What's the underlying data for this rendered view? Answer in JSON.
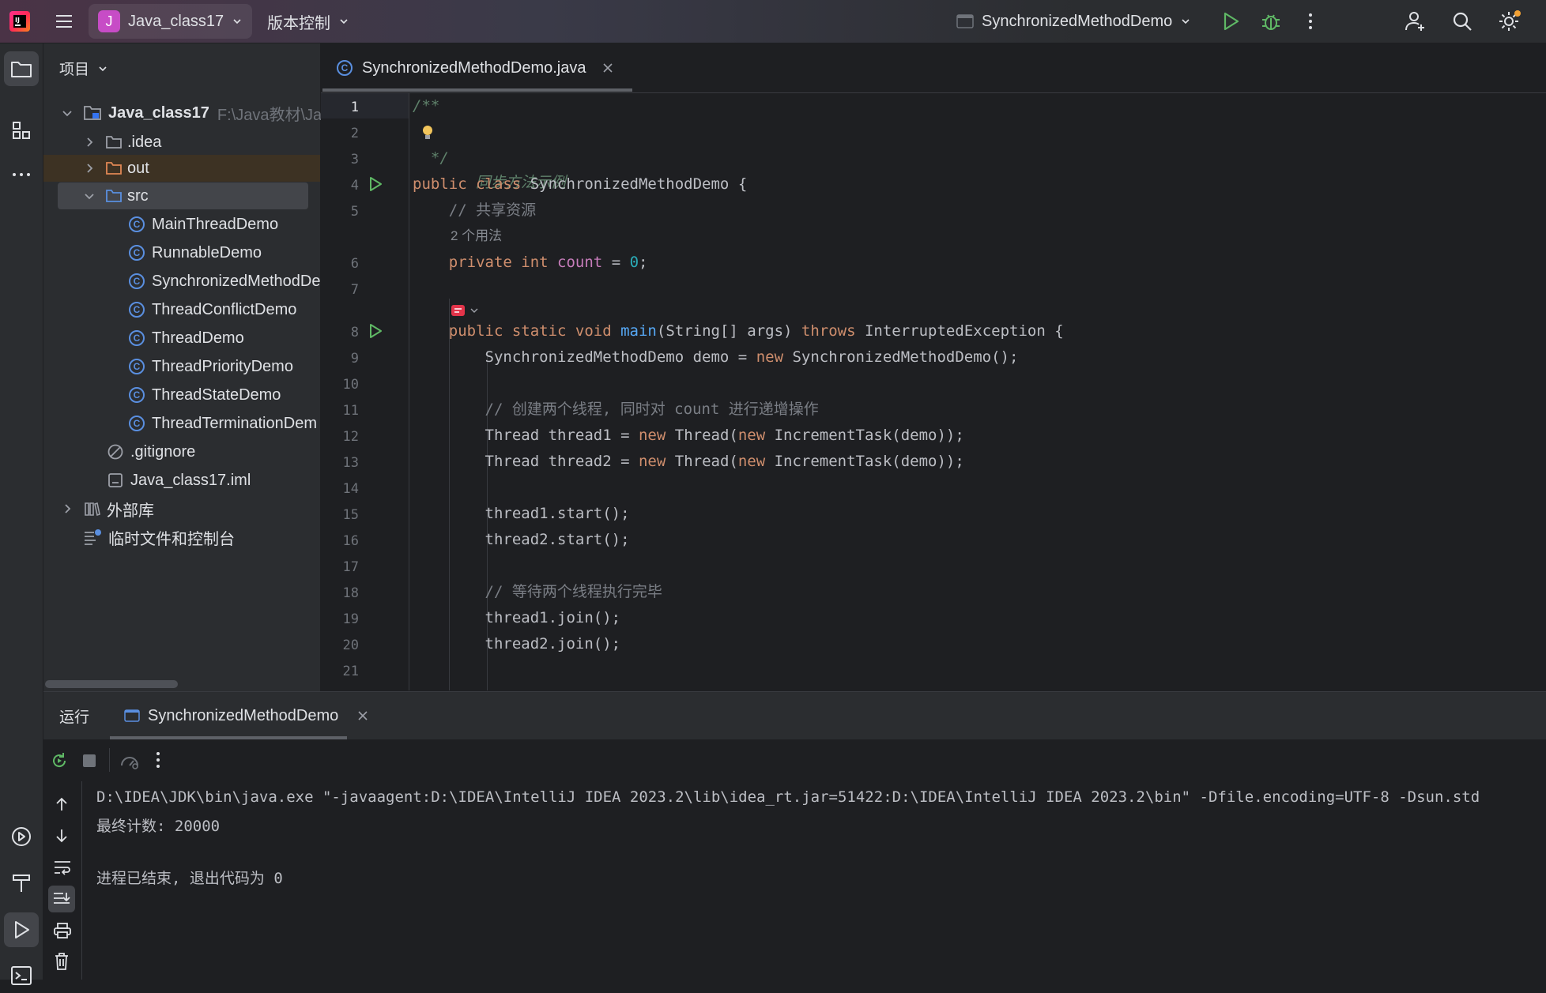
{
  "titlebar": {
    "project_badge": "J",
    "project_name": "Java_class17",
    "vcs_label": "版本控制",
    "run_config": "SynchronizedMethodDemo",
    "icons": [
      "ide-logo-icon",
      "hamburger-menu-icon",
      "run-icon",
      "debug-icon",
      "more-vertical-icon",
      "add-user-icon",
      "search-icon",
      "settings-icon"
    ]
  },
  "project_panel": {
    "header": "项目",
    "root": {
      "name": "Java_class17",
      "path": "F:\\Java教材\\Ja"
    },
    "items": [
      {
        "label": ".idea"
      },
      {
        "label": "out"
      },
      {
        "label": "src"
      },
      {
        "label": "MainThreadDemo"
      },
      {
        "label": "RunnableDemo"
      },
      {
        "label": "SynchronizedMethodDe"
      },
      {
        "label": "ThreadConflictDemo"
      },
      {
        "label": "ThreadDemo"
      },
      {
        "label": "ThreadPriorityDemo"
      },
      {
        "label": "ThreadStateDemo"
      },
      {
        "label": "ThreadTerminationDem"
      },
      {
        "label": ".gitignore"
      },
      {
        "label": "Java_class17.iml"
      },
      {
        "label": "外部库"
      },
      {
        "label": "临时文件和控制台"
      }
    ]
  },
  "editor": {
    "tab_label": "SynchronizedMethodDemo.java",
    "class_icon_letter": "C",
    "line_numbers": [
      "1",
      "2",
      "3",
      "4",
      "5",
      "6",
      "7",
      "8",
      "9",
      "10",
      "11",
      "12",
      "13",
      "14",
      "15",
      "16",
      "17",
      "18",
      "19",
      "20",
      "21"
    ],
    "usage_hint": "2 个用法",
    "code": {
      "l1": "/**",
      "l2": "同步方法示例",
      "l3": "*/",
      "l4a": "public class ",
      "l4b": "SynchronizedMethodDemo {",
      "l5": "// 共享资源",
      "l6a": "private int ",
      "l6b": "count",
      "l6c": " = ",
      "l6d": "0",
      "l6e": ";",
      "l8a": "public static void ",
      "l8b": "main",
      "l8c": "(String[] args) ",
      "l8d": "throws ",
      "l8e": "InterruptedException {",
      "l9a": "SynchronizedMethodDemo demo = ",
      "l9b": "new ",
      "l9c": "SynchronizedMethodDemo();",
      "l11": "// 创建两个线程, 同时对 count 进行递增操作",
      "l12a": "Thread thread1 = ",
      "l12b": "new ",
      "l12c": "Thread(",
      "l12d": "new ",
      "l12e": "IncrementTask(demo));",
      "l13a": "Thread thread2 = ",
      "l13b": "new ",
      "l13c": "Thread(",
      "l13d": "new ",
      "l13e": "IncrementTask(demo));",
      "l15": "thread1.start();",
      "l16": "thread2.start();",
      "l18": "// 等待两个线程执行完毕",
      "l19": "thread1.join();",
      "l20": "thread2.join();"
    }
  },
  "run_panel": {
    "tab_run": "运行",
    "tab_config": "SynchronizedMethodDemo",
    "console": [
      "D:\\IDEA\\JDK\\bin\\java.exe \"-javaagent:D:\\IDEA\\IntelliJ IDEA 2023.2\\lib\\idea_rt.jar=51422:D:\\IDEA\\IntelliJ IDEA 2023.2\\bin\" -Dfile.encoding=UTF-8 -Dsun.std",
      "最终计数: 20000",
      "",
      "进程已结束, 退出代码为 0"
    ]
  },
  "colors": {
    "accent": "#3574f0",
    "run_green": "#5fb865",
    "badge_purple": "#c74cc6",
    "keyword": "#cf8e6d",
    "method": "#56a8f5",
    "field": "#c77dbb",
    "number": "#2aacb8"
  }
}
